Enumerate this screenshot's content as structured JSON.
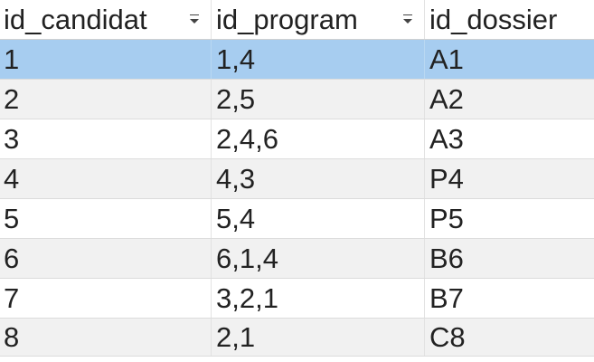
{
  "table": {
    "columns": [
      {
        "label": "id_candidat",
        "has_filter": true
      },
      {
        "label": "id_program",
        "has_filter": true
      },
      {
        "label": "id_dossier",
        "has_filter": false
      }
    ],
    "rows": [
      {
        "id_candidat": "1",
        "id_program": "1,4",
        "id_dossier": "A1",
        "selected": true
      },
      {
        "id_candidat": "2",
        "id_program": "2,5",
        "id_dossier": "A2",
        "selected": false
      },
      {
        "id_candidat": "3",
        "id_program": "2,4,6",
        "id_dossier": "A3",
        "selected": false
      },
      {
        "id_candidat": "4",
        "id_program": "4,3",
        "id_dossier": "P4",
        "selected": false
      },
      {
        "id_candidat": "5",
        "id_program": "5,4",
        "id_dossier": "P5",
        "selected": false
      },
      {
        "id_candidat": "6",
        "id_program": "6,1,4",
        "id_dossier": "B6",
        "selected": false
      },
      {
        "id_candidat": "7",
        "id_program": "3,2,1",
        "id_dossier": "B7",
        "selected": false
      },
      {
        "id_candidat": "8",
        "id_program": "2,1",
        "id_dossier": "C8",
        "selected": false
      }
    ]
  },
  "icons": {
    "filter_dropdown": "chevron-down-icon"
  },
  "colors": {
    "selected_row": "#a7cdf0",
    "alt_row": "#f1f1f1",
    "text": "#222222"
  }
}
